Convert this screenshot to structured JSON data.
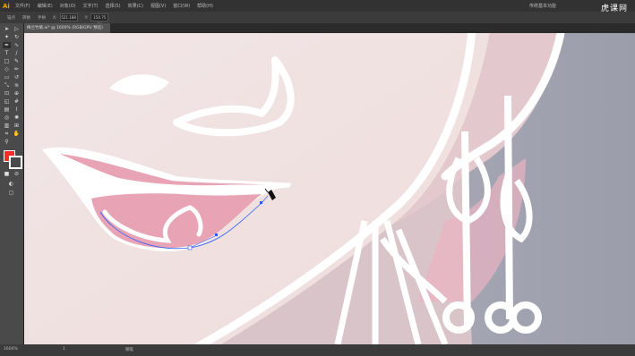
{
  "menubar": {
    "app_logo": "Ai",
    "items": [
      "文件(F)",
      "编辑(E)",
      "对象(O)",
      "文字(T)",
      "选择(S)",
      "效果(C)",
      "视图(V)",
      "窗口(W)",
      "帮助(H)"
    ],
    "workspace": "传统基本功能",
    "watermark": "虎课网"
  },
  "controlbar": {
    "anchor_label": "锚点",
    "convert_label": "转换",
    "handle_label": "手柄",
    "x_value": "521.188",
    "y_value": "154.75 px"
  },
  "tab": {
    "title": "梅兰竹菊.ai* @ 1600% (RGB/GPU 预览)"
  },
  "tools": {
    "names": [
      "selection-tool",
      "direct-selection-tool",
      "magic-wand-tool",
      "lasso-tool",
      "pen-tool",
      "curvature-tool",
      "type-tool",
      "line-tool",
      "rectangle-tool",
      "paintbrush-tool",
      "shaper-tool",
      "pencil-tool",
      "eraser-tool",
      "rotate-tool",
      "scale-tool",
      "width-tool",
      "free-transform-tool",
      "shape-builder-tool",
      "perspective-tool",
      "mesh-tool",
      "gradient-tool",
      "eyedropper-tool",
      "blend-tool",
      "symbol-sprayer-tool",
      "column-graph-tool",
      "artboard-tool",
      "slice-tool",
      "hand-tool",
      "zoom-tool"
    ],
    "fill_color": "#ff2a2a",
    "stroke_color": "#ffffff"
  },
  "status": {
    "zoom": "1600%",
    "page": "1",
    "mode": "钢笔"
  },
  "colors": {
    "skin": "#f0dfdf",
    "lip": "#e8a4b4",
    "outline": "#ffffff",
    "background_gray": "#a9aab6",
    "path": "#2a5cff"
  }
}
